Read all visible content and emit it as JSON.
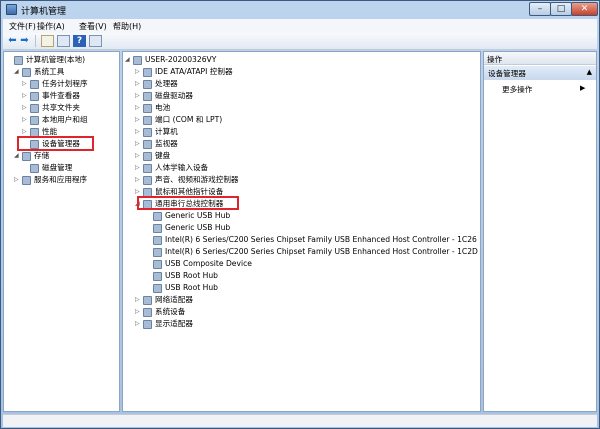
{
  "window": {
    "title": "计算机管理"
  },
  "menu": [
    "文件(F)",
    "操作(A)",
    "查看(V)",
    "帮助(H)"
  ],
  "left_tree": [
    {
      "label": "计算机管理(本地)",
      "indent": 0,
      "toggle": ""
    },
    {
      "label": "系统工具",
      "indent": 1,
      "toggle": "◢"
    },
    {
      "label": "任务计划程序",
      "indent": 2,
      "toggle": "▷"
    },
    {
      "label": "事件查看器",
      "indent": 2,
      "toggle": "▷"
    },
    {
      "label": "共享文件夹",
      "indent": 2,
      "toggle": "▷"
    },
    {
      "label": "本地用户和组",
      "indent": 2,
      "toggle": "▷"
    },
    {
      "label": "性能",
      "indent": 2,
      "toggle": "▷"
    },
    {
      "label": "设备管理器",
      "indent": 2,
      "toggle": ""
    },
    {
      "label": "存储",
      "indent": 1,
      "toggle": "◢"
    },
    {
      "label": "磁盘管理",
      "indent": 2,
      "toggle": ""
    },
    {
      "label": "服务和应用程序",
      "indent": 1,
      "toggle": "▷"
    }
  ],
  "device_tree": {
    "root": "USER-20200326VY",
    "items": [
      {
        "label": "IDE ATA/ATAPI 控制器",
        "indent": 1,
        "toggle": "▷"
      },
      {
        "label": "处理器",
        "indent": 1,
        "toggle": "▷"
      },
      {
        "label": "磁盘驱动器",
        "indent": 1,
        "toggle": "▷"
      },
      {
        "label": "电池",
        "indent": 1,
        "toggle": "▷"
      },
      {
        "label": "端口 (COM 和 LPT)",
        "indent": 1,
        "toggle": "▷"
      },
      {
        "label": "计算机",
        "indent": 1,
        "toggle": "▷"
      },
      {
        "label": "监视器",
        "indent": 1,
        "toggle": "▷"
      },
      {
        "label": "键盘",
        "indent": 1,
        "toggle": "▷"
      },
      {
        "label": "人体学输入设备",
        "indent": 1,
        "toggle": "▷"
      },
      {
        "label": "声音、视频和游戏控制器",
        "indent": 1,
        "toggle": "▷"
      },
      {
        "label": "鼠标和其他指针设备",
        "indent": 1,
        "toggle": "▷"
      },
      {
        "label": "通用串行总线控制器",
        "indent": 1,
        "toggle": "◢"
      },
      {
        "label": "Generic USB Hub",
        "indent": 2,
        "toggle": ""
      },
      {
        "label": "Generic USB Hub",
        "indent": 2,
        "toggle": ""
      },
      {
        "label": "Intel(R) 6 Series/C200 Series Chipset Family USB Enhanced Host Controller - 1C26",
        "indent": 2,
        "toggle": ""
      },
      {
        "label": "Intel(R) 6 Series/C200 Series Chipset Family USB Enhanced Host Controller - 1C2D",
        "indent": 2,
        "toggle": ""
      },
      {
        "label": "USB Composite Device",
        "indent": 2,
        "toggle": ""
      },
      {
        "label": "USB Root Hub",
        "indent": 2,
        "toggle": ""
      },
      {
        "label": "USB Root Hub",
        "indent": 2,
        "toggle": ""
      },
      {
        "label": "网络适配器",
        "indent": 1,
        "toggle": "▷"
      },
      {
        "label": "系统设备",
        "indent": 1,
        "toggle": "▷"
      },
      {
        "label": "显示适配器",
        "indent": 1,
        "toggle": "▷"
      }
    ]
  },
  "actions": {
    "header": "操作",
    "section": "设备管理器",
    "more": "更多操作"
  }
}
